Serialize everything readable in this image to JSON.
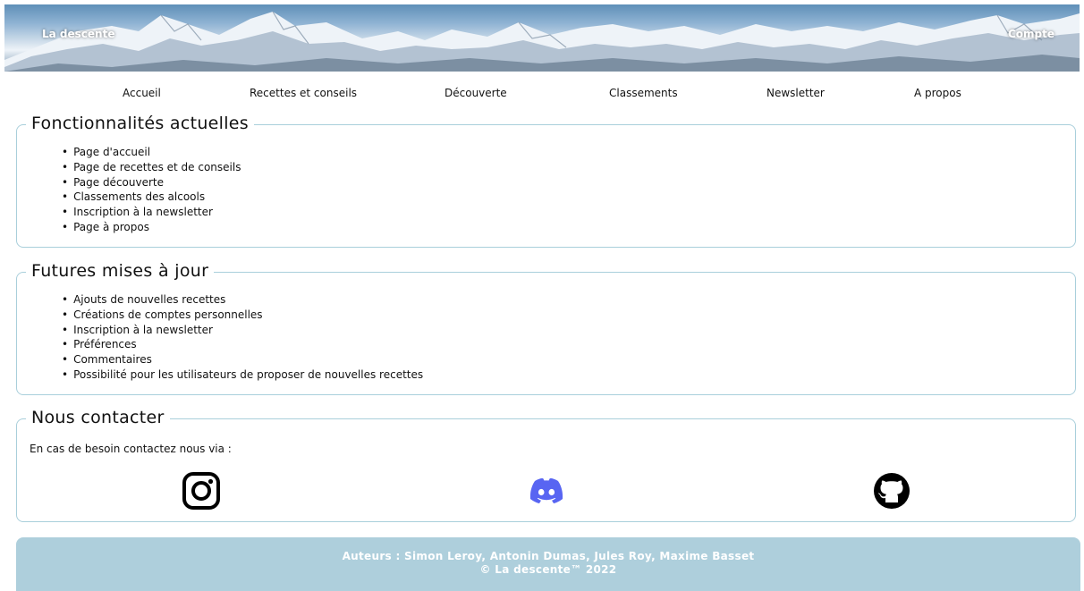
{
  "header": {
    "site_name": "La descente",
    "account_label": "Compte"
  },
  "nav": {
    "items": [
      {
        "label": "Accueil"
      },
      {
        "label": "Recettes et conseils"
      },
      {
        "label": "Découverte"
      },
      {
        "label": "Classements"
      },
      {
        "label": "Newsletter"
      },
      {
        "label": "A propos"
      }
    ]
  },
  "current_features": {
    "title": "Fonctionnalités actuelles",
    "items": [
      "Page d'accueil",
      "Page de recettes et de conseils",
      "Page découverte",
      "Classements des alcools",
      "Inscription à la newsletter",
      "Page à propos"
    ]
  },
  "future_updates": {
    "title": "Futures mises à jour",
    "items": [
      "Ajouts de nouvelles recettes",
      "Créations de comptes personnelles",
      "Inscription à la newsletter",
      "Préférences",
      "Commentaires",
      "Possibilité pour les utilisateurs de proposer de nouvelles recettes"
    ]
  },
  "contact": {
    "title": "Nous contacter",
    "text": "En cas de besoin contactez nous via :",
    "links": [
      {
        "icon": "instagram-icon"
      },
      {
        "icon": "discord-icon",
        "color": "#5865f2"
      },
      {
        "icon": "github-icon"
      }
    ]
  },
  "footer": {
    "authors": "Auteurs : Simon Leroy, Antonin Dumas, Jules Roy, Maxime Basset",
    "copyright": "© La descente™ 2022"
  },
  "colors": {
    "border": "#a9cfdb",
    "footer_bg": "#aecfdc",
    "discord": "#5865f2"
  }
}
